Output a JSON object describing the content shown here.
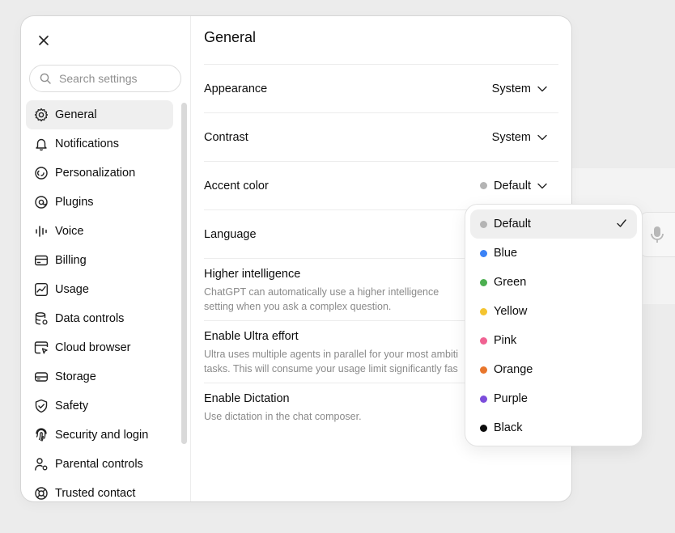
{
  "sidebar": {
    "search_placeholder": "Search settings",
    "items": [
      {
        "label": "General",
        "icon": "gear-icon"
      },
      {
        "label": "Notifications",
        "icon": "bell-icon"
      },
      {
        "label": "Personalization",
        "icon": "personalization-icon"
      },
      {
        "label": "Plugins",
        "icon": "plugins-icon"
      },
      {
        "label": "Voice",
        "icon": "voice-waveform-icon"
      },
      {
        "label": "Billing",
        "icon": "credit-card-icon"
      },
      {
        "label": "Usage",
        "icon": "chart-icon"
      },
      {
        "label": "Data controls",
        "icon": "database-icon"
      },
      {
        "label": "Cloud browser",
        "icon": "browser-icon"
      },
      {
        "label": "Storage",
        "icon": "storage-icon"
      },
      {
        "label": "Safety",
        "icon": "shield-icon"
      },
      {
        "label": "Security and login",
        "icon": "fingerprint-icon"
      },
      {
        "label": "Parental controls",
        "icon": "parental-icon"
      },
      {
        "label": "Trusted contact",
        "icon": "lifebuoy-icon"
      }
    ]
  },
  "main": {
    "title": "General",
    "appearance": {
      "label": "Appearance",
      "value": "System"
    },
    "contrast": {
      "label": "Contrast",
      "value": "System"
    },
    "accent": {
      "label": "Accent color",
      "value": "Default",
      "dot_color": "#b4b4b4"
    },
    "language": {
      "label": "Language"
    },
    "higher_intelligence": {
      "label": "Higher intelligence",
      "desc1": "ChatGPT can automatically use a higher intelligence",
      "desc2": "setting when you ask a complex question."
    },
    "ultra": {
      "label": "Enable Ultra effort",
      "desc1": "Ultra uses multiple agents in parallel for your most ambiti",
      "desc2": "tasks. This will consume your usage limit significantly fas"
    },
    "dictation": {
      "label": "Enable Dictation",
      "desc1": "Use dictation in the chat composer."
    }
  },
  "accent_dropdown": {
    "selected": "Default",
    "options": [
      {
        "label": "Default",
        "color": "#b4b4b4"
      },
      {
        "label": "Blue",
        "color": "#3b82f6"
      },
      {
        "label": "Green",
        "color": "#4caf50"
      },
      {
        "label": "Yellow",
        "color": "#f4c430"
      },
      {
        "label": "Pink",
        "color": "#f06292"
      },
      {
        "label": "Orange",
        "color": "#e8762c"
      },
      {
        "label": "Purple",
        "color": "#7c4ddb"
      },
      {
        "label": "Black",
        "color": "#0d0d0d"
      }
    ]
  }
}
